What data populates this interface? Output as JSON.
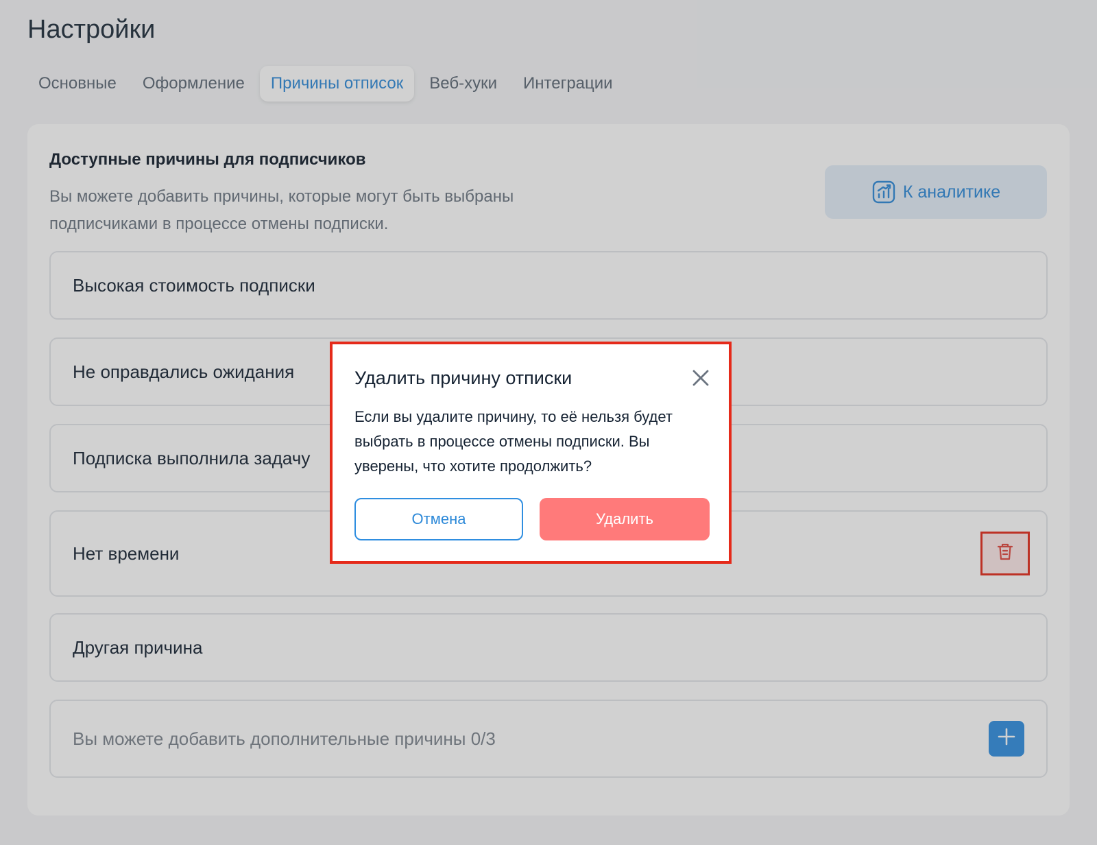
{
  "page": {
    "title": "Настройки"
  },
  "tabs": [
    {
      "label": "Основные"
    },
    {
      "label": "Оформление"
    },
    {
      "label": "Причины отписок",
      "active": true
    },
    {
      "label": "Веб-хуки"
    },
    {
      "label": "Интеграции"
    }
  ],
  "card": {
    "heading": "Доступные причины для подписчиков",
    "description": "Вы можете добавить причины, которые могут быть выбраны подписчиками в процессе отмены подписки.",
    "analytics_label": "К аналитике"
  },
  "reasons": [
    {
      "label": "Высокая стоимость подписки"
    },
    {
      "label": "Не оправдались ожидания"
    },
    {
      "label": "Подписка выполнила задачу"
    },
    {
      "label": "Нет времени"
    },
    {
      "label": "Другая причина"
    }
  ],
  "add_reason": {
    "placeholder": "Вы можете добавить дополнительные причины 0/3"
  },
  "modal": {
    "title": "Удалить причину отписки",
    "text": "Если вы удалите причину, то её нельзя будет выбрать в процессе отмены подписки. Вы уверены, что хотите продолжить?",
    "cancel_label": "Отмена",
    "delete_label": "Удалить"
  },
  "colors": {
    "accent": "#2b88d8",
    "danger": "#ff7a7a",
    "highlight": "#e52a1a"
  },
  "icons": {
    "analytics": "chart-icon",
    "delete": "trash-icon",
    "add": "plus-icon",
    "close": "close-icon"
  }
}
